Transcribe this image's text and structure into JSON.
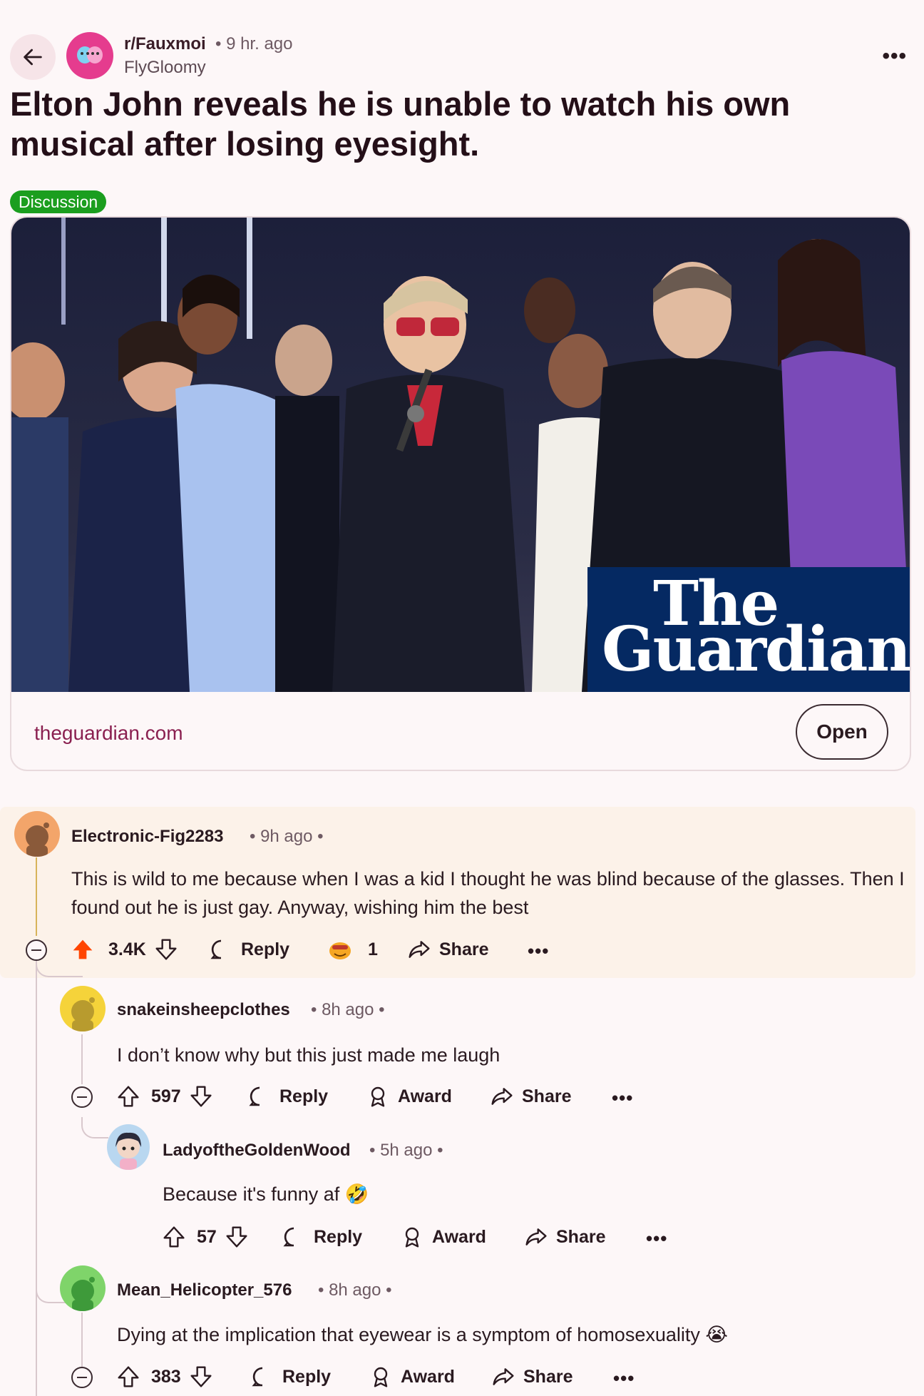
{
  "header": {
    "subreddit": "r/Fauxmoi",
    "time": "• 9 hr. ago",
    "author": "FlyGloomy",
    "more": "•••"
  },
  "post": {
    "title": "Elton John reveals he is unable to watch his own musical after losing eyesight.",
    "flair": "Discussion",
    "flair_color": "#1b9e1f",
    "link": {
      "domain": "theguardian.com",
      "open_label": "Open",
      "logo_line1": "The",
      "logo_line2": "Guardian"
    }
  },
  "comments": [
    {
      "user": "Electronic-Fig2283",
      "time": "• 9h ago •",
      "body": "This is wild to me because when I was a kid I thought he was blind because of the glasses. Then I found out he is just gay. Anyway, wishing him the best",
      "votes": "3.4K",
      "reply": "Reply",
      "award_count": "1",
      "share": "Share",
      "more": "•••",
      "upvoted": true,
      "accent": "#ff4500"
    },
    {
      "user": "snakeinsheepclothes",
      "time": "• 8h ago •",
      "body": "I don’t know why but this just made me laugh",
      "votes": "597",
      "reply": "Reply",
      "award": "Award",
      "share": "Share",
      "more": "•••"
    },
    {
      "user": "LadyoftheGoldenWood",
      "time": "• 5h ago •",
      "body": "Because it's funny af 🤣",
      "votes": "57",
      "reply": "Reply",
      "award": "Award",
      "share": "Share",
      "more": "•••"
    },
    {
      "user": "Mean_Helicopter_576",
      "time": "• 8h ago •",
      "body": "Dying at the implication that eyewear is a symptom of homosexuality 😭",
      "votes": "383",
      "reply": "Reply",
      "award": "Award",
      "share": "Share",
      "more": "•••"
    }
  ]
}
